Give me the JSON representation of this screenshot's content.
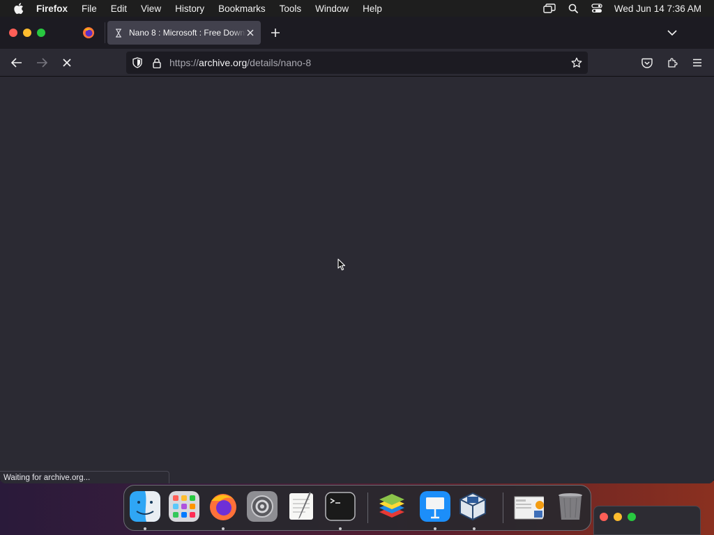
{
  "menubar": {
    "app_name": "Firefox",
    "items": [
      "File",
      "Edit",
      "View",
      "History",
      "Bookmarks",
      "Tools",
      "Window",
      "Help"
    ],
    "clock": "Wed Jun 14  7:36 AM"
  },
  "tabs": {
    "active": {
      "title": "Nano 8 : Microsoft : Free Downl"
    }
  },
  "urlbar": {
    "scheme": "https://",
    "host": "archive.org",
    "path": "/details/nano-8"
  },
  "status": {
    "text": "Waiting for archive.org..."
  },
  "dock": {
    "items": [
      "Finder",
      "Launchpad",
      "Firefox",
      "System Preferences",
      "TextEdit",
      "Terminal",
      "BlueStacks",
      "Keynote",
      "VirtualBox",
      "Preview",
      "Trash"
    ]
  },
  "colors": {
    "window_bg": "#2b2a33",
    "tabbar_bg": "#1c1b22",
    "active_tab_bg": "#42414d",
    "urlbar_bg": "#1c1b22"
  }
}
